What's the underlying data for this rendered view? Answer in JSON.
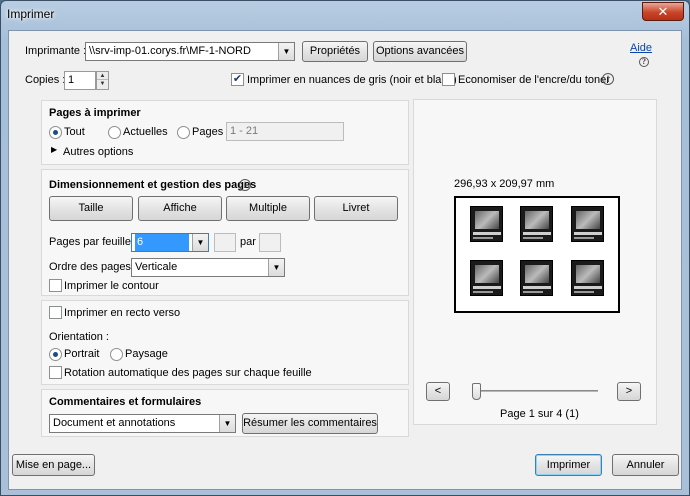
{
  "window": {
    "title": "Imprimer",
    "close_glyph": "✕"
  },
  "printer": {
    "label": "Imprimante :",
    "value": "\\\\srv-imp-01.corys.fr\\MF-1-NORD",
    "properties_button": "Propriétés",
    "advanced_button": "Options avancées",
    "help_link": "Aide",
    "help_icon": "help-circle-icon"
  },
  "copies": {
    "label": "Copies :",
    "value": "1"
  },
  "options": {
    "grayscale_label": "Imprimer en nuances de gris (noir et blanc)",
    "grayscale_checked": true,
    "save_ink_label": "Economiser de l'encre/du toner",
    "save_ink_checked": false
  },
  "pages": {
    "title": "Pages à imprimer",
    "all_label": "Tout",
    "current_label": "Actuelles",
    "pages_label": "Pages",
    "pages_range": "1 - 21",
    "selected": "all",
    "more_options": "Autres options"
  },
  "sizing": {
    "title": "Dimensionnement et gestion des pages",
    "buttons": [
      "Taille",
      "Affiche",
      "Multiple",
      "Livret"
    ],
    "per_sheet_label": "Pages par feuille :",
    "per_sheet_value": "6",
    "by_label": "par",
    "order_label": "Ordre des pages :",
    "order_value": "Verticale",
    "border_label": "Imprimer le contour",
    "border_checked": false
  },
  "duplex": {
    "label": "Imprimer en recto verso",
    "checked": false,
    "orientation_label": "Orientation :",
    "portrait_label": "Portrait",
    "landscape_label": "Paysage",
    "selected": "portrait",
    "autorotate_label": "Rotation automatique des pages sur chaque feuille",
    "autorotate_checked": false
  },
  "comments": {
    "title": "Commentaires et formulaires",
    "value": "Document et annotations",
    "summarize_button": "Résumer les commentaires"
  },
  "preview": {
    "dimensions": "296,93 x 209,97 mm",
    "prev_button": "<",
    "next_button": ">",
    "page_status": "Page 1 sur 4 (1)",
    "slider_fraction": 0.0
  },
  "footer": {
    "setup_button": "Mise en page...",
    "print_button": "Imprimer",
    "cancel_button": "Annuler"
  }
}
